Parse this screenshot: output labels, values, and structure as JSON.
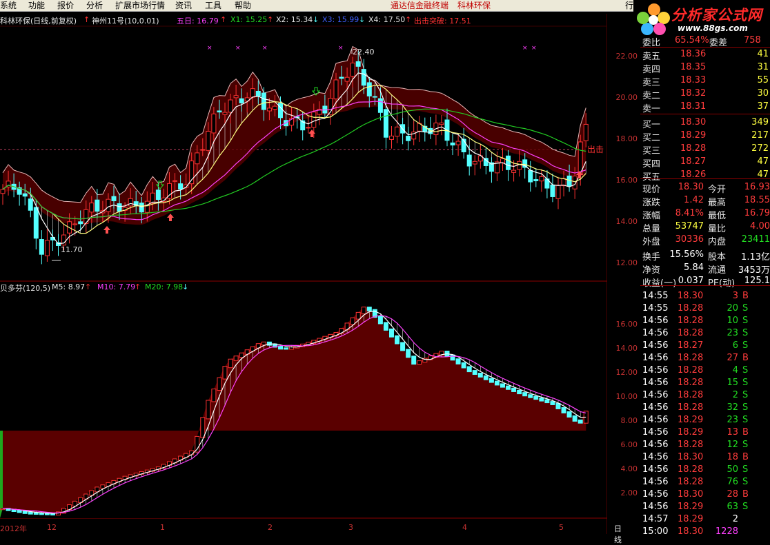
{
  "menu": {
    "items": [
      "系统",
      "功能",
      "报价",
      "分析",
      "扩展市场行情",
      "资讯",
      "工具",
      "帮助"
    ],
    "promo": "通达信金融终端",
    "stock_name": "科林环保",
    "right_fragment": "行"
  },
  "logo": {
    "title": "分析家公式网",
    "url": "www.88gs.com"
  },
  "main_chart": {
    "title": "科林环保(日线,前复权)",
    "indicator_name": "神州11号(10,0.01)",
    "wu_ri": "五日: 16.79",
    "x1": "X1: 15.25",
    "x2": "X2: 15.34",
    "x3": "X3: 15.99",
    "x4": "X4: 17.50",
    "breakout": "出击突破: 17.51",
    "high_annot": "22.40",
    "low_annot": "11.70",
    "signal_label": "出击",
    "yaxis": [
      "22.00",
      "20.00",
      "18.00",
      "16.00",
      "14.00",
      "12.00"
    ],
    "colors": {
      "up": "#ff3232",
      "down": "#54ffff",
      "ma5": "#ffffff",
      "ma10": "#ffff80",
      "ma20": "#ff40ff",
      "ma60": "#22cc22",
      "band": "#5a0000"
    }
  },
  "sub_chart": {
    "title": "贝多芬(120,5)",
    "m5": "M5: 8.97",
    "m10": "M10: 7.79",
    "m20": "M20: 7.98",
    "yaxis": [
      "16.00",
      "14.00",
      "12.00",
      "10.00",
      "8.00",
      "6.00",
      "4.00",
      "2.00"
    ]
  },
  "xaxis": {
    "labels": [
      "2012年",
      "12",
      "1",
      "2",
      "3",
      "4",
      "5"
    ],
    "period": "日线"
  },
  "right_panel": {
    "top_partial_left": "委比",
    "top_partial_val": "65.54%",
    "top_partial_right": "委差",
    "top_partial_num": "758",
    "order_book": [
      {
        "label": "卖五",
        "price": "18.36",
        "vol": "41"
      },
      {
        "label": "卖四",
        "price": "18.35",
        "vol": "31"
      },
      {
        "label": "卖三",
        "price": "18.33",
        "vol": "55"
      },
      {
        "label": "卖二",
        "price": "18.32",
        "vol": "30"
      },
      {
        "label": "卖一",
        "price": "18.31",
        "vol": "37"
      },
      {
        "label": "买一",
        "price": "18.30",
        "vol": "349"
      },
      {
        "label": "买二",
        "price": "18.29",
        "vol": "217"
      },
      {
        "label": "买三",
        "price": "18.28",
        "vol": "272"
      },
      {
        "label": "买四",
        "price": "18.27",
        "vol": "47"
      },
      {
        "label": "买五",
        "price": "18.26",
        "vol": "47"
      }
    ],
    "stats": [
      {
        "l1": "现价",
        "v1": "18.30",
        "c1": "red",
        "l2": "今开",
        "v2": "16.93",
        "c2": "red"
      },
      {
        "l1": "涨跌",
        "v1": "1.42",
        "c1": "red",
        "l2": "最高",
        "v2": "18.55",
        "c2": "red"
      },
      {
        "l1": "涨幅",
        "v1": "8.41%",
        "c1": "red",
        "l2": "最低",
        "v2": "16.79",
        "c2": "red"
      },
      {
        "l1": "总量",
        "v1": "53747",
        "c1": "yel",
        "l2": "量比",
        "v2": "4.00",
        "c2": "red"
      },
      {
        "l1": "外盘",
        "v1": "30336",
        "c1": "red",
        "l2": "内盘",
        "v2": "23411",
        "c2": "grn"
      },
      {
        "l1": "换手",
        "v1": "15.56%",
        "c1": "wht",
        "l2": "股本",
        "v2": "1.13亿",
        "c2": "wht"
      },
      {
        "l1": "净资",
        "v1": "5.84",
        "c1": "wht",
        "l2": "流通",
        "v2": "3453万",
        "c2": "wht"
      },
      {
        "l1": "收益(一)",
        "v1": "0.037",
        "c1": "wht",
        "l2": "PE(动)",
        "v2": "125.1",
        "c2": "wht"
      }
    ],
    "ticks": [
      {
        "time": "14:55",
        "price": "18.30",
        "vol": "3",
        "bs": "B"
      },
      {
        "time": "14:55",
        "price": "18.28",
        "vol": "20",
        "bs": "S"
      },
      {
        "time": "14:56",
        "price": "18.28",
        "vol": "10",
        "bs": "S"
      },
      {
        "time": "14:56",
        "price": "18.28",
        "vol": "23",
        "bs": "S"
      },
      {
        "time": "14:56",
        "price": "18.27",
        "vol": "6",
        "bs": "S"
      },
      {
        "time": "14:56",
        "price": "18.28",
        "vol": "27",
        "bs": "B"
      },
      {
        "time": "14:56",
        "price": "18.28",
        "vol": "4",
        "bs": "S"
      },
      {
        "time": "14:56",
        "price": "18.28",
        "vol": "15",
        "bs": "S"
      },
      {
        "time": "14:56",
        "price": "18.28",
        "vol": "2",
        "bs": "S"
      },
      {
        "time": "14:56",
        "price": "18.28",
        "vol": "32",
        "bs": "S"
      },
      {
        "time": "14:56",
        "price": "18.29",
        "vol": "23",
        "bs": "S"
      },
      {
        "time": "14:56",
        "price": "18.29",
        "vol": "13",
        "bs": "B"
      },
      {
        "time": "14:56",
        "price": "18.28",
        "vol": "12",
        "bs": "S"
      },
      {
        "time": "14:56",
        "price": "18.30",
        "vol": "18",
        "bs": "B"
      },
      {
        "time": "14:56",
        "price": "18.28",
        "vol": "50",
        "bs": "S"
      },
      {
        "time": "14:56",
        "price": "18.28",
        "vol": "76",
        "bs": "S"
      },
      {
        "time": "14:56",
        "price": "18.30",
        "vol": "28",
        "bs": "B"
      },
      {
        "time": "14:56",
        "price": "18.29",
        "vol": "63",
        "bs": "S"
      },
      {
        "time": "14:57",
        "price": "18.29",
        "vol": "2",
        "bs": ""
      },
      {
        "time": "15:00",
        "price": "18.30",
        "vol": "1228",
        "bs": ""
      }
    ]
  }
}
